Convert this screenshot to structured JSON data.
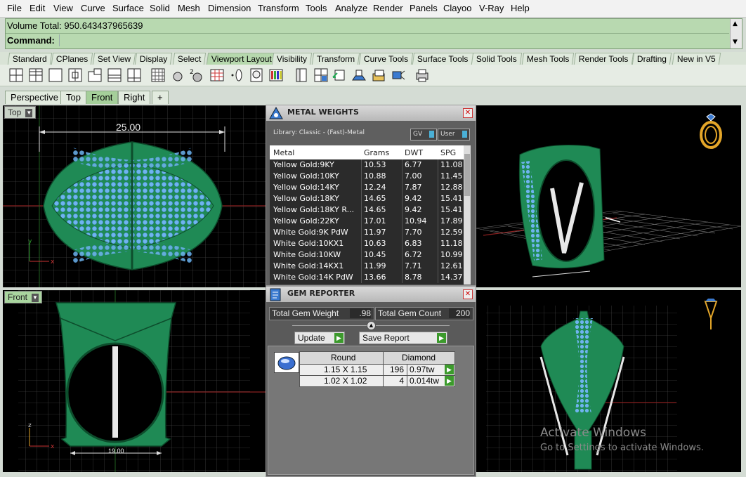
{
  "menu": [
    "File",
    "Edit",
    "View",
    "Curve",
    "Surface",
    "Solid",
    "Mesh",
    "Dimension",
    "Transform",
    "Tools",
    "Analyze",
    "Render",
    "Panels",
    "Clayoo",
    "V-Ray",
    "Help"
  ],
  "command_area": {
    "history_line": "Volume Total: 950.643437965639",
    "command_label": "Command:",
    "command_value": ""
  },
  "toolbar_tabs": [
    "Standard",
    "CPlanes",
    "Set View",
    "Display",
    "Select",
    "Viewport Layout",
    "Visibility",
    "Transform",
    "Curve Tools",
    "Surface Tools",
    "Solid Tools",
    "Mesh Tools",
    "Render Tools",
    "Drafting",
    "New in V5"
  ],
  "active_toolbar_tab": "Viewport Layout",
  "viewport_tabs": [
    "Perspective",
    "Top",
    "Front",
    "Right",
    "+"
  ],
  "active_viewport_tab": "Front",
  "viewports": {
    "top": {
      "label": "Top",
      "dimension": "25.00"
    },
    "front": {
      "label": "Front",
      "dimension": "19.00"
    }
  },
  "metal_weights": {
    "title": "METAL WEIGHTS",
    "library": "Library: Classic - (Fast)-Metal",
    "toggle_gv": "GV",
    "toggle_user": "User",
    "columns": [
      "Metal",
      "Grams",
      "DWT",
      "SPG"
    ],
    "rows": [
      [
        "Yellow Gold:9KY",
        "10.53",
        "6.77",
        "11.08"
      ],
      [
        "Yellow Gold:10KY",
        "10.88",
        "7.00",
        "11.45"
      ],
      [
        "Yellow Gold:14KY",
        "12.24",
        "7.87",
        "12.88"
      ],
      [
        "Yellow Gold:18KY",
        "14.65",
        "9.42",
        "15.41"
      ],
      [
        "Yellow Gold:18KY R...",
        "14.65",
        "9.42",
        "15.41"
      ],
      [
        "Yellow Gold:22KY",
        "17.01",
        "10.94",
        "17.89"
      ],
      [
        "White Gold:9K PdW",
        "11.97",
        "7.70",
        "12.59"
      ],
      [
        "White Gold:10KX1",
        "10.63",
        "6.83",
        "11.18"
      ],
      [
        "White Gold:10KW",
        "10.45",
        "6.72",
        "10.99"
      ],
      [
        "White Gold:14KX1",
        "11.99",
        "7.71",
        "12.61"
      ],
      [
        "White Gold:14K PdW",
        "13.66",
        "8.78",
        "14.37"
      ]
    ]
  },
  "gem_reporter": {
    "title": "GEM REPORTER",
    "total_weight_label": "Total Gem Weight",
    "total_weight_value": ".98",
    "total_count_label": "Total Gem Count",
    "total_count_value": "200",
    "update_label": "Update",
    "save_label": "Save Report",
    "shape_header": "Round",
    "material_header": "Diamond",
    "rows": [
      {
        "size": "1.15 X 1.15",
        "count": "196",
        "weight": "0.97tw"
      },
      {
        "size": "1.02 X 1.02",
        "count": "4",
        "weight": "0.014tw"
      }
    ]
  },
  "watermark": {
    "title": "Activate Windows",
    "subtitle": "Go to Settings to activate Windows."
  },
  "colors": {
    "ring_green": "#1f8a55",
    "gem_blue": "#6fb4ef",
    "command_bg": "#b8d9b0",
    "active_tab": "#a5cf9a"
  }
}
